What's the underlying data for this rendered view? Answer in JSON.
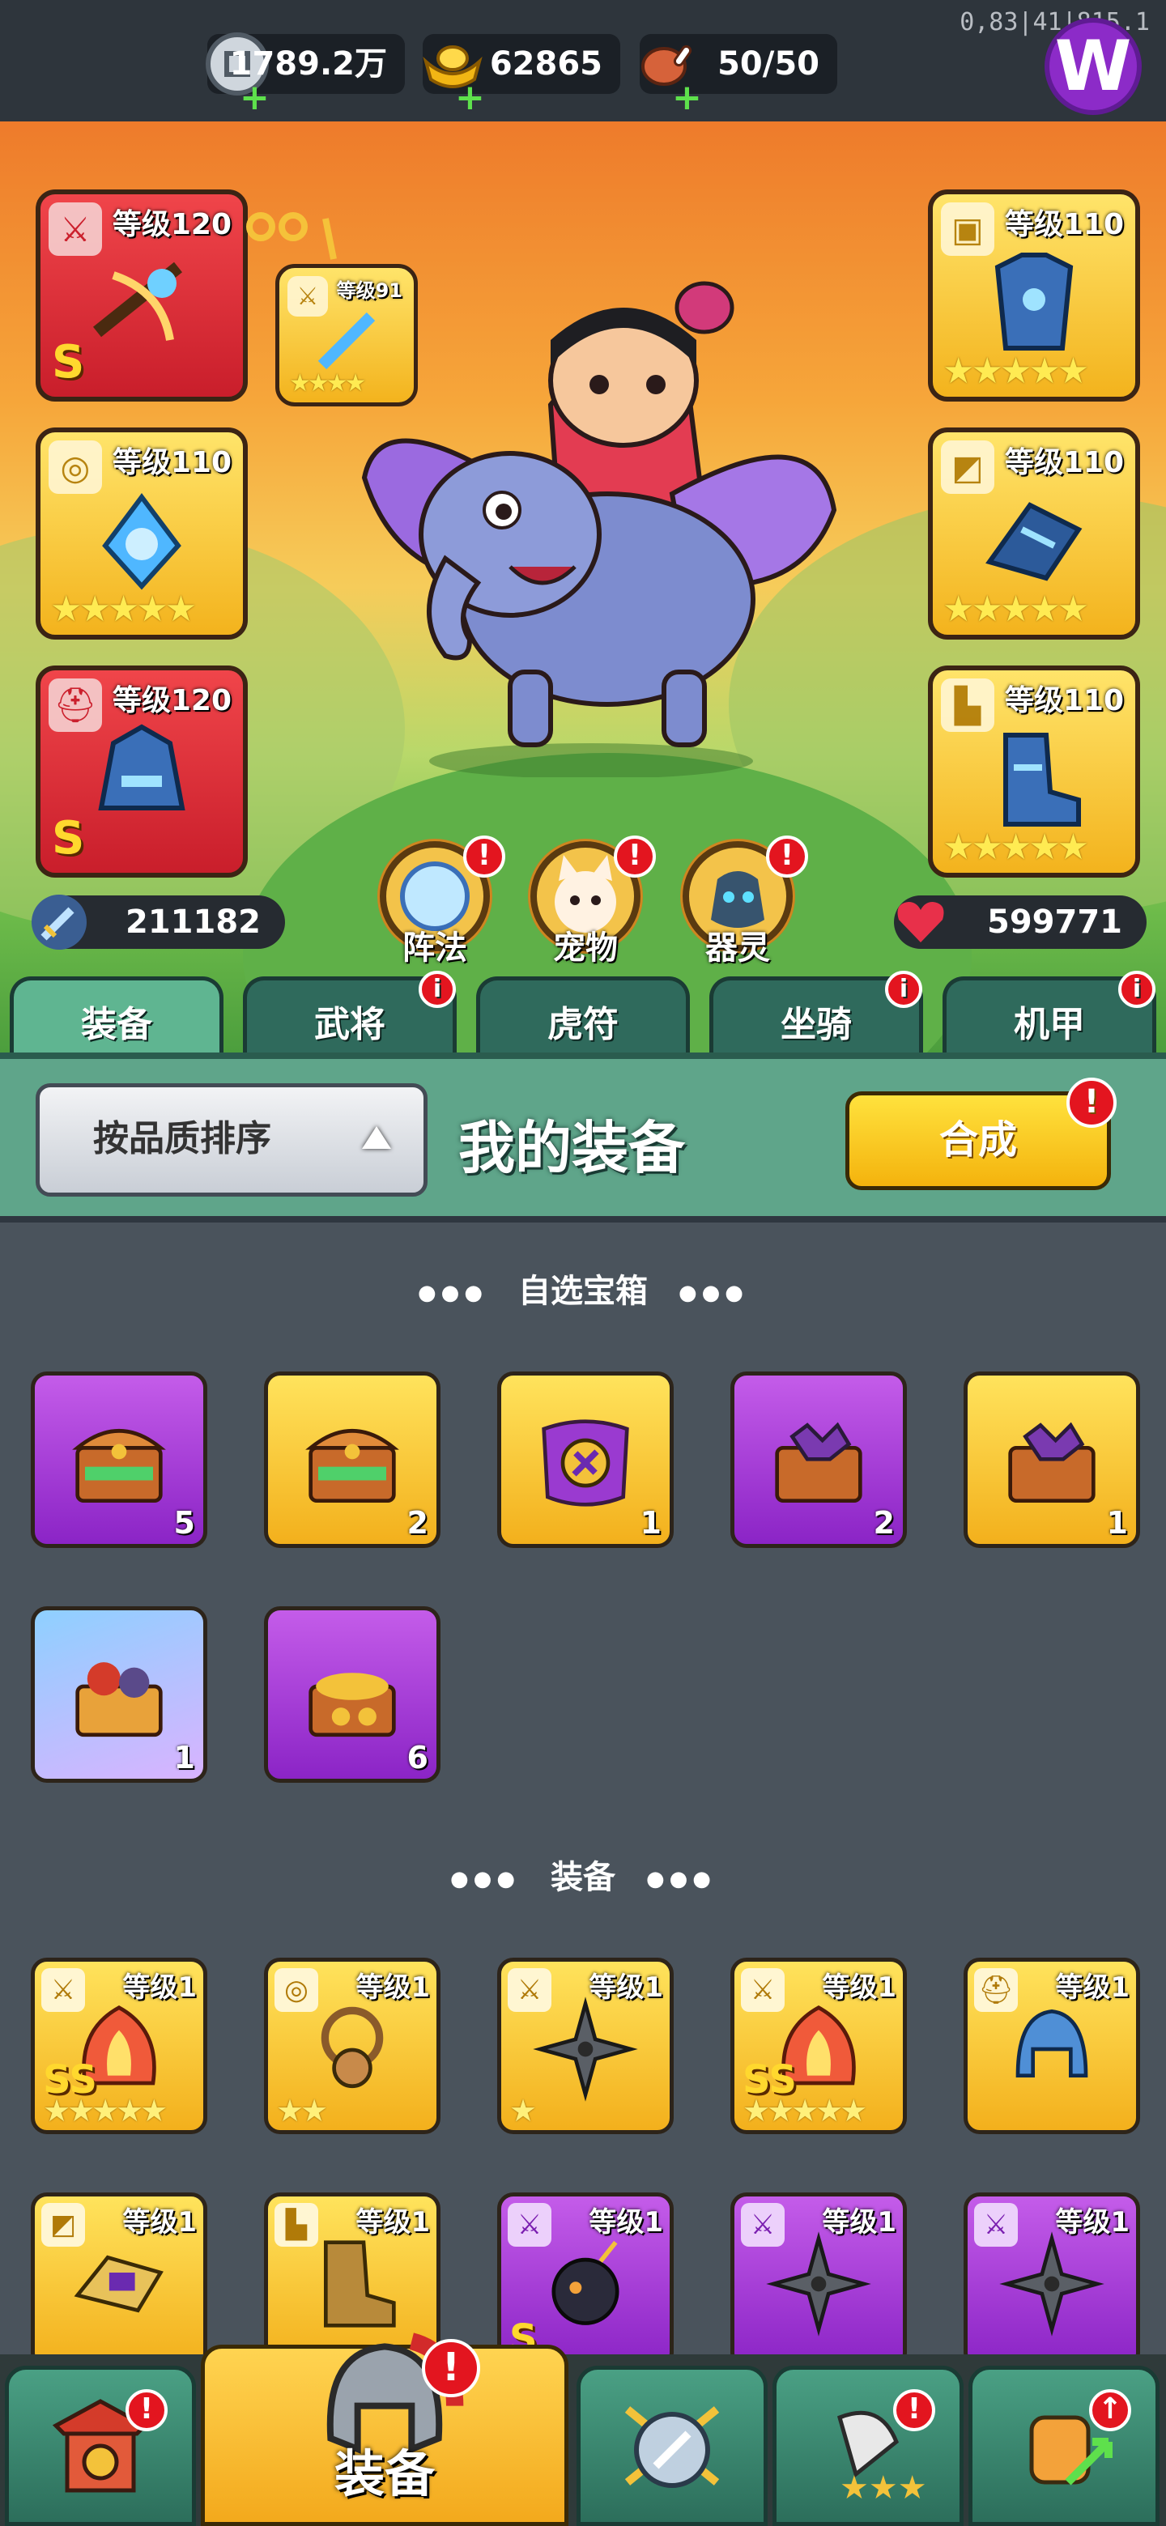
{
  "resources": {
    "silver": "1789.2万",
    "gold": "62865",
    "stamina": "50/50"
  },
  "debug_overlay": "0,83|41|815.1",
  "hero": {
    "left_slots": [
      {
        "level": "等级120",
        "grade": "S",
        "color": "red",
        "tag": "sword-icon",
        "art": "crossbow"
      },
      {
        "level": "等级110",
        "stars": 5,
        "color": "gold",
        "tag": "medal-icon",
        "art": "ice-amulet"
      },
      {
        "level": "等级120",
        "grade": "S",
        "color": "red",
        "tag": "helmet-icon",
        "art": "ice-helmet"
      }
    ],
    "right_slots": [
      {
        "level": "等级110",
        "stars": 5,
        "color": "gold",
        "tag": "armor-icon",
        "art": "ice-armor"
      },
      {
        "level": "等级110",
        "stars": 5,
        "color": "gold",
        "tag": "bracer-icon",
        "art": "ice-bracer"
      },
      {
        "level": "等级110",
        "stars": 5,
        "color": "gold",
        "tag": "boot-icon",
        "art": "ice-boots"
      }
    ],
    "small_slot": {
      "level": "等级91",
      "stars": 4,
      "tag": "sword-icon"
    },
    "attack": "211182",
    "hp": "599771",
    "round_buttons": [
      {
        "label": "阵法",
        "badge": "!"
      },
      {
        "label": "宠物",
        "badge": "!"
      },
      {
        "label": "器灵",
        "badge": "!"
      }
    ]
  },
  "tabs": [
    {
      "label": "装备",
      "active": true,
      "badge": false
    },
    {
      "label": "武将",
      "active": false,
      "badge": true
    },
    {
      "label": "虎符",
      "active": false,
      "badge": false
    },
    {
      "label": "坐骑",
      "active": false,
      "badge": true
    },
    {
      "label": "机甲",
      "active": false,
      "badge": true
    }
  ],
  "panel": {
    "sort_label": "按品质排序",
    "title": "我的装备",
    "merge_label": "合成",
    "merge_badge": "!"
  },
  "chest_section": {
    "title": "自选宝箱",
    "items": [
      {
        "color": "purple",
        "count": "5",
        "art": "treasure-chest"
      },
      {
        "color": "gold",
        "count": "2",
        "art": "treasure-chest"
      },
      {
        "color": "gold",
        "count": "1",
        "art": "sword-chest"
      },
      {
        "color": "purple",
        "count": "2",
        "art": "puzzle-chest"
      },
      {
        "color": "gold",
        "count": "1",
        "art": "puzzle-chest"
      },
      {
        "color": "blue",
        "count": "1",
        "art": "gear-chest"
      },
      {
        "color": "purple",
        "count": "6",
        "art": "gold-chest"
      }
    ]
  },
  "equip_section": {
    "title": "装备",
    "items": [
      {
        "color": "gold",
        "level": "等级1",
        "grade": "SS",
        "stars": 5,
        "tag": "sword-icon",
        "art": "flame-weapon"
      },
      {
        "color": "gold",
        "level": "等级1",
        "stars": 2,
        "tag": "medal-icon",
        "art": "amulet"
      },
      {
        "color": "gold",
        "level": "等级1",
        "stars": 1,
        "tag": "sword-icon",
        "art": "shuriken"
      },
      {
        "color": "gold",
        "level": "等级1",
        "grade": "SS",
        "stars": 5,
        "tag": "sword-icon",
        "art": "flame-weapon"
      },
      {
        "color": "gold",
        "level": "等级1",
        "stars": 0,
        "tag": "helmet-icon",
        "art": "blue-helmet"
      },
      {
        "color": "gold",
        "level": "等级1",
        "tag": "bracer-icon",
        "art": "gem-bracer"
      },
      {
        "color": "gold",
        "level": "等级1",
        "tag": "boot-icon",
        "art": "boots"
      },
      {
        "color": "purple",
        "level": "等级1",
        "grade": "S",
        "tag": "sword-icon",
        "art": "bomb"
      },
      {
        "color": "purple",
        "level": "等级1",
        "tag": "sword-icon",
        "art": "shuriken"
      },
      {
        "color": "purple",
        "level": "等级1",
        "tag": "sword-icon",
        "art": "shuriken"
      }
    ]
  },
  "bottom_nav": [
    {
      "label": "",
      "icon": "shop-gate-icon",
      "badge": true
    },
    {
      "label": "装备",
      "icon": "helmet-icon",
      "active": true,
      "badge": true
    },
    {
      "label": "",
      "icon": "shield-swords-icon",
      "badge": false
    },
    {
      "label": "",
      "icon": "horn-stars-icon",
      "badge": true
    },
    {
      "label": "",
      "icon": "fist-upgrade-icon",
      "badge": true
    }
  ],
  "colors": {
    "accent_gold": "#f3b01c",
    "accent_purple": "#8b24c6",
    "tab_green": "#5fb591",
    "badge_red": "#e3151f"
  }
}
